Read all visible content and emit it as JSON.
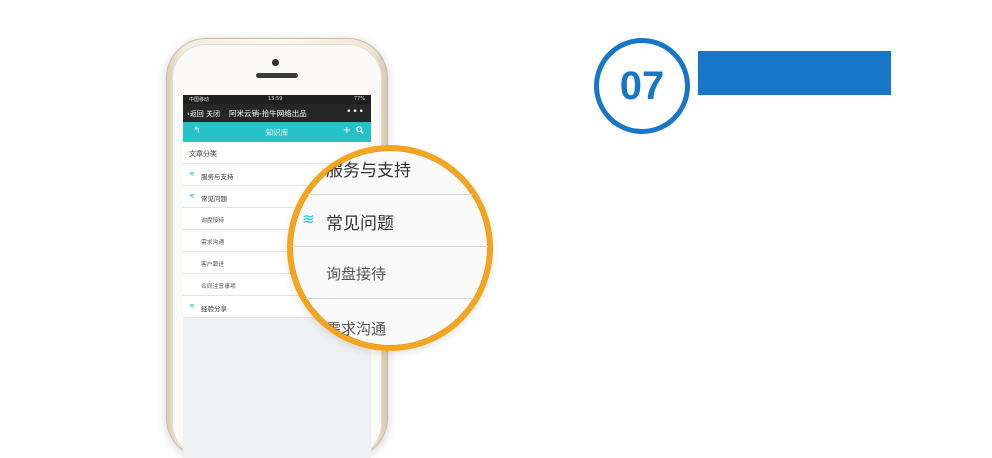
{
  "status": {
    "carrier": "中国移动",
    "time": "13:59",
    "battery": "77%"
  },
  "nav": {
    "back": "返回",
    "close": "关闭",
    "title": "阿米云销-拾牛网络出品",
    "more": "•••"
  },
  "toolbar": {
    "back_icon": "↰",
    "title": "知识库",
    "add_icon": "+",
    "search_icon": "🔍"
  },
  "list": {
    "header": "文章分类",
    "items": [
      {
        "label": "服务与支持",
        "type": "category"
      },
      {
        "label": "常见问题",
        "type": "category"
      },
      {
        "label": "询盘接待",
        "type": "sub"
      },
      {
        "label": "需求沟通",
        "type": "sub"
      },
      {
        "label": "客户跟进",
        "type": "sub"
      },
      {
        "label": "合同注意事项",
        "type": "sub"
      },
      {
        "label": "经验分享",
        "type": "category"
      }
    ]
  },
  "magnifier": {
    "rows": [
      "服务与支持",
      "常见问题",
      "询盘接待",
      "需求沟通"
    ]
  },
  "badge": {
    "number": "07"
  },
  "colors": {
    "accent": "#27c1c8",
    "brand_blue": "#1776c7",
    "lens_ring": "#f5a41d"
  },
  "icons": {
    "category": "layers-icon"
  }
}
